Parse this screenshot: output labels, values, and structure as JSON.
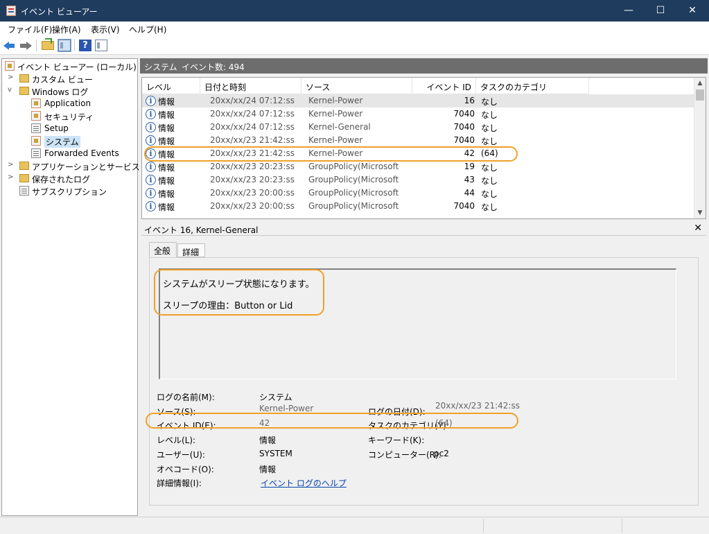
{
  "window": {
    "title": "イベント ビューアー",
    "minimize": "—",
    "maximize": "☐",
    "close": "✕"
  },
  "menu": [
    "ファイル(F)",
    "操作(A)",
    "表示(V)",
    "ヘルプ(H)"
  ],
  "toolbar": {
    "icons": [
      "back-icon",
      "forward-icon",
      "up-folder-icon",
      "show-pane-icon",
      "help-icon",
      "properties-icon"
    ],
    "help_glyph": "?"
  },
  "tree": {
    "root": "イベント ビューアー (ローカル)",
    "custom_views": "カスタム ビュー",
    "windows_logs": "Windows ログ",
    "application": "Application",
    "security": "セキュリティ",
    "setup": "Setup",
    "system": "システム",
    "forwarded": "Forwarded Events",
    "apps_services": "アプリケーションとサービス ログ",
    "saved_logs": "保存されたログ",
    "subscriptions": "サブスクリプション"
  },
  "panel": {
    "title": "システム",
    "count": "イベント数: 494"
  },
  "grid": {
    "headers": {
      "level": "レベル",
      "date": "日付と時刻",
      "source": "ソース",
      "id": "イベント ID",
      "task": "タスクのカテゴリ"
    },
    "rows": [
      {
        "level": "情報",
        "date": "20xx/xx/24 07:12:ss",
        "source": "Kernel-Power",
        "id": "16",
        "task": "なし",
        "selected": true
      },
      {
        "level": "情報",
        "date": "20xx/xx/24 07:12:ss",
        "source": "Kernel-Power",
        "id": "7040",
        "task": "なし"
      },
      {
        "level": "情報",
        "date": "20xx/xx/24 07:12:ss",
        "source": "Kernel-General",
        "id": "7040",
        "task": "なし"
      },
      {
        "level": "情報",
        "date": "20xx/xx/23 21:42:ss",
        "source": "Kernel-Power",
        "id": "7040",
        "task": "なし"
      },
      {
        "level": "情報",
        "date": "20xx/xx/23 21:42:ss",
        "source": "Kernel-Power",
        "id": "42",
        "task": "(64)"
      },
      {
        "level": "情報",
        "date": "20xx/xx/23 20:23:ss",
        "source": "GroupPolicy(Microsoft",
        "id": "19",
        "task": "なし"
      },
      {
        "level": "情報",
        "date": "20xx/xx/23 20:23:ss",
        "source": "GroupPolicy(Microsoft",
        "id": "43",
        "task": "なし"
      },
      {
        "level": "情報",
        "date": "20xx/xx/23 20:00:ss",
        "source": "GroupPolicy(Microsoft",
        "id": "44",
        "task": "なし"
      },
      {
        "level": "情報",
        "date": "20xx/xx/23 20:00:ss",
        "source": "GroupPolicy(Microsoft",
        "id": "7040",
        "task": "なし"
      }
    ]
  },
  "detail": {
    "title": "イベント 16, Kernel-General",
    "close": "✕",
    "tabs": [
      "全般",
      "詳細"
    ],
    "message_line1": "システムがスリープ状態になります。",
    "message_line2": "スリープの理由：Button or Lid",
    "labels": {
      "log_name": "ログの名前(M):",
      "source": "ソース(S):",
      "event_id": "イベント ID(E):",
      "level": "レベル(L):",
      "user": "ユーザー(U):",
      "opcode": "オペコード(O):",
      "more_info": "詳細情報(I):",
      "logged": "ログの日付(D):",
      "task": "タスクのカテゴリ(Y):",
      "keywords": "キーワード(K):",
      "computer": "コンピューター(R):"
    },
    "values": {
      "log_name": "システム",
      "source": "Kernel-Power",
      "event_id": "42",
      "level": "情報",
      "user": "SYSTEM",
      "opcode": "情報",
      "more_info": "イベント ログのヘルプ",
      "logged": "20xx/xx/23 21:42:ss",
      "task": "(64)",
      "keywords": "",
      "computer": "pc2"
    }
  },
  "colors": {
    "titlebar": "#1f3c5e",
    "panel_header": "#6d6d6d",
    "highlight": "#f0a028",
    "link": "#0645ad"
  }
}
